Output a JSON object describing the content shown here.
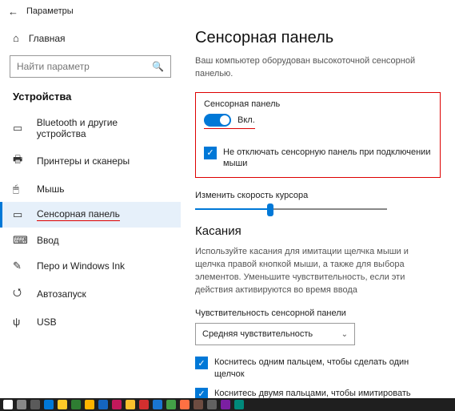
{
  "titlebar": {
    "label": "Параметры"
  },
  "home": {
    "label": "Главная"
  },
  "search": {
    "placeholder": "Найти параметр"
  },
  "category": {
    "label": "Устройства"
  },
  "nav": {
    "bluetooth": "Bluetooth и другие устройства",
    "printers": "Принтеры и сканеры",
    "mouse": "Мышь",
    "touchpad": "Сенсорная панель",
    "input": "Ввод",
    "pen": "Перо и Windows Ink",
    "autoplay": "Автозапуск",
    "usb": "USB"
  },
  "page": {
    "title": "Сенсорная панель",
    "equip": "Ваш компьютер оборудован высокоточной сенсорной панелью.",
    "tp_label": "Сенсорная панель",
    "toggle_on": "Вкл.",
    "keep_on": "Не отключать сенсорную панель при подключении мыши",
    "cursor_speed": "Изменить скорость курсора",
    "touches_title": "Касания",
    "touches_desc": "Используйте касания для имитации щелчка мыши и щелчка правой кнопкой мыши, а также для выбора элементов. Уменьшите чувствительность, если эти действия активируются во время ввода",
    "sensitivity_label": "Чувствительность сенсорной панели",
    "sensitivity_value": "Средняя чувствительность",
    "tap1": "Коснитесь одним пальцем, чтобы сделать один щелчок",
    "tap2": "Коснитесь двумя пальцами, чтобы имитировать щелчок"
  },
  "taskbar_colors": [
    "#fff",
    "#888",
    "#5a5a5a",
    "#0078d7",
    "#ffca28",
    "#2e7d32",
    "#ffb300",
    "#1565c0",
    "#c2185b",
    "#fbc02d",
    "#d32f2f",
    "#1976d2",
    "#43a047",
    "#ff7043",
    "#6d4c41",
    "#616161",
    "#7b1fa2",
    "#00897b"
  ]
}
